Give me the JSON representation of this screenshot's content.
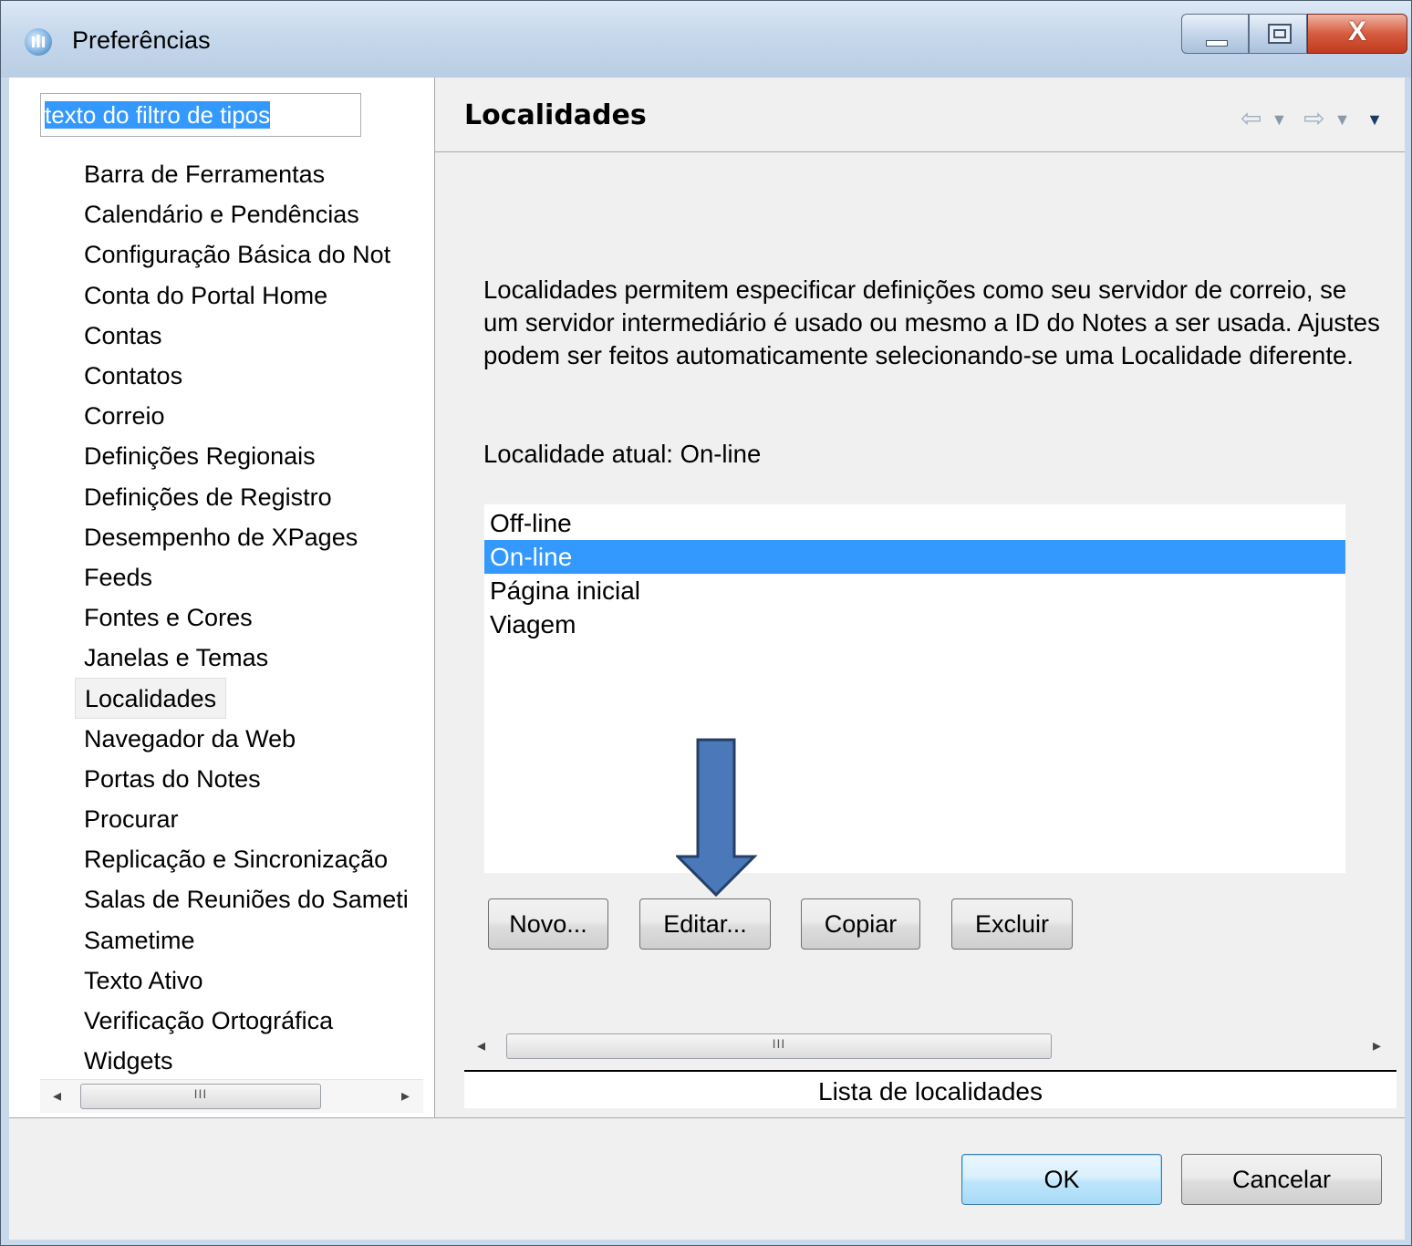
{
  "window": {
    "title": "Preferências"
  },
  "filter": {
    "value": "texto do filtro de tipos"
  },
  "tree": {
    "items": [
      "Barra de Ferramentas",
      "Calendário e Pendências",
      "Configuração Básica do Not",
      "Conta do Portal Home",
      "Contas",
      "Contatos",
      "Correio",
      "Definições Regionais",
      "Definições de Registro",
      "Desempenho de XPages",
      "Feeds",
      "Fontes e Cores",
      "Janelas e Temas",
      "Localidades",
      "Navegador da Web",
      "Portas do Notes",
      "Procurar",
      "Replicação e Sincronização",
      "Salas de Reuniões do Sameti",
      "Sametime",
      "Texto Ativo",
      "Verificação Ortográfica",
      "Widgets"
    ],
    "selected": "Localidades"
  },
  "page": {
    "title": "Localidades",
    "description": "Localidades permitem especificar definições como seu servidor de correio, se um servidor intermediário é usado ou mesmo a ID do Notes a ser usada.  Ajustes podem ser feitos automaticamente selecionando-se uma Localidade diferente.",
    "current_location": "Localidade atual: On-line",
    "locations": [
      "Off-line",
      "On-line",
      "Página inicial",
      "Viagem"
    ],
    "selected_location": "On-line",
    "buttons": {
      "new": "Novo...",
      "edit": "Editar...",
      "copy": "Copiar",
      "delete": "Excluir"
    },
    "status_label": "Lista de localidades"
  },
  "dialog": {
    "ok": "OK",
    "cancel": "Cancelar"
  },
  "icons": {
    "scroll_left": "◂",
    "scroll_right": "▸",
    "scroll_grip": "III",
    "back": "⇦",
    "forward": "⇨",
    "dropdown": "▼"
  },
  "colors": {
    "selection": "#3399ff",
    "annotation_arrow": "#4a78b8"
  }
}
